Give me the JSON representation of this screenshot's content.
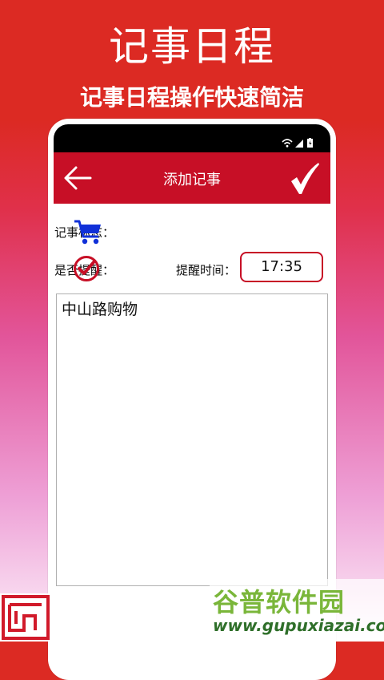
{
  "promo": {
    "title": "记事日程",
    "subtitle": "记事日程操作快速简洁"
  },
  "status_bar": {
    "icons": [
      "wifi-icon",
      "signal-icon",
      "battery-icon"
    ]
  },
  "app_bar": {
    "title": "添加记事",
    "back_icon": "arrow-left-icon",
    "confirm_icon": "checkmark-icon",
    "color": "#c70f26"
  },
  "form": {
    "tag_label": "记事标志：",
    "tag_icon": "shopping-cart-icon",
    "remind_label": "是否提醒：",
    "remind_checked": true,
    "remind_time_label": "提醒时间：",
    "remind_time_value": "17:35",
    "note_text": "中山路购物"
  },
  "watermark": {
    "text": "谷普软件园",
    "url": "www.gupuxiazai.com"
  }
}
